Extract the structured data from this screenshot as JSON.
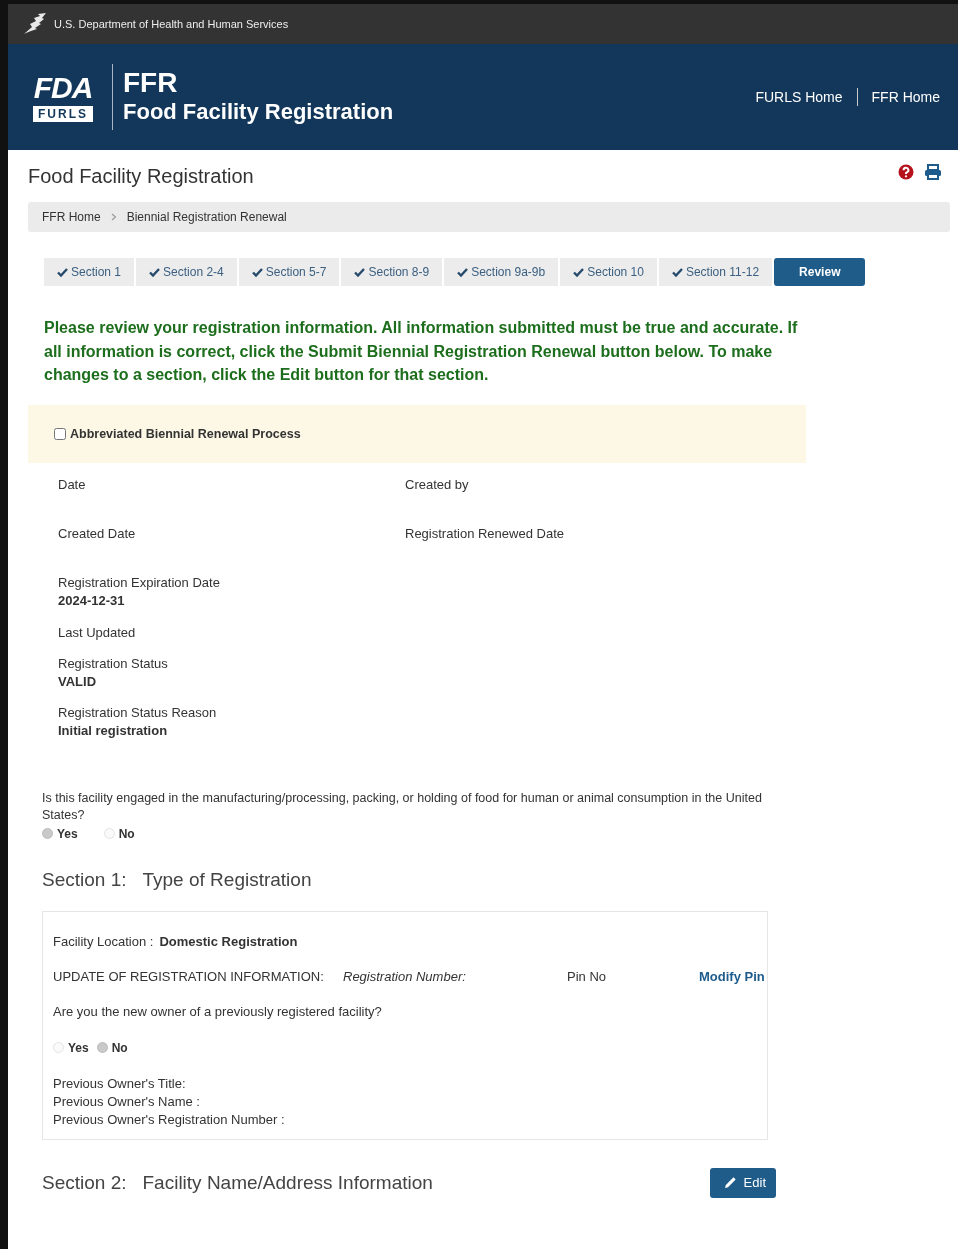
{
  "agency_bar": {
    "text": "U.S. Department of Health and Human Services"
  },
  "header": {
    "logo_top": "FDA",
    "logo_bottom": "FURLS",
    "app_abbr": "FFR",
    "app_name": "Food Facility Registration",
    "links": [
      "FURLS Home",
      "FFR Home"
    ]
  },
  "page_title": "Food Facility Registration",
  "breadcrumb": [
    "FFR Home",
    "Biennial Registration Renewal"
  ],
  "steps": [
    {
      "label": "Section 1",
      "completed": true,
      "selected": false
    },
    {
      "label": "Section 2-4",
      "completed": true,
      "selected": false
    },
    {
      "label": "Section 5-7",
      "completed": true,
      "selected": false
    },
    {
      "label": "Section 8-9",
      "completed": true,
      "selected": false
    },
    {
      "label": "Section 9a-9b",
      "completed": true,
      "selected": false
    },
    {
      "label": "Section 10",
      "completed": true,
      "selected": false
    },
    {
      "label": "Section 11-12",
      "completed": true,
      "selected": false
    },
    {
      "label": "Review",
      "completed": false,
      "selected": true
    }
  ],
  "instructions": "Please review your registration information. All information submitted must be true and accurate. If all information is correct, click the Submit Biennial Registration Renewal button below. To make changes to a section, click the Edit button for that section.",
  "abbreviated": {
    "label": "Abbreviated Biennial Renewal Process",
    "checked": false
  },
  "field_rows": [
    {
      "cells": [
        {
          "label": "Date"
        },
        {
          "label": "Created by"
        }
      ]
    },
    {
      "cells": [
        {
          "label": "Created Date"
        },
        {
          "label": "Registration Renewed Date"
        }
      ]
    },
    {
      "cells": [
        {
          "label": "Registration Expiration Date",
          "value": "2024-12-31"
        }
      ]
    },
    {
      "cells": [
        {
          "label": "Last Updated"
        }
      ]
    },
    {
      "cells": [
        {
          "label": "Registration Status",
          "value": "VALID"
        }
      ]
    },
    {
      "cells": [
        {
          "label": "Registration Status Reason",
          "value": "Initial registration"
        }
      ]
    }
  ],
  "question": {
    "text": "Is this facility engaged in the manufacturing/processing, packing, or holding of food for human or animal consumption in the United States?",
    "options": [
      {
        "label": "Yes",
        "selected": true
      },
      {
        "label": "No",
        "selected": false
      }
    ]
  },
  "section1": {
    "number": "Section 1:",
    "title": "Type of Registration",
    "facility_location": {
      "label": "Facility Location :",
      "value": "Domestic Registration"
    },
    "update": {
      "label": "UPDATE OF REGISTRATION INFORMATION:",
      "registration_number": "Registration Number:",
      "pin": "Pin No",
      "link": "Modify Pin"
    },
    "owner_question": {
      "text": "Are you the new owner of a previously registered facility?",
      "options": [
        {
          "label": "Yes",
          "selected": false
        },
        {
          "label": "No",
          "selected": true
        }
      ]
    },
    "previous_owner": [
      "Previous Owner's Title:",
      "Previous Owner's Name :",
      "Previous Owner's Registration Number :"
    ]
  },
  "section2": {
    "number": "Section 2:",
    "title": "Facility Name/Address Information",
    "button": "Edit"
  }
}
